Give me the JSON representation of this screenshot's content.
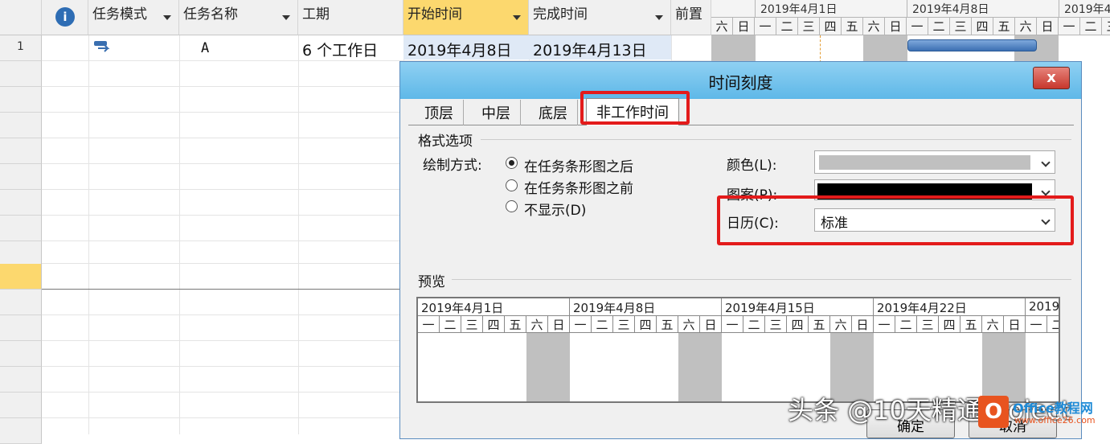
{
  "table": {
    "columns": [
      {
        "label": ""
      },
      {
        "label": "任务模式"
      },
      {
        "label": "任务名称"
      },
      {
        "label": "工期"
      },
      {
        "label": "开始时间"
      },
      {
        "label": "完成时间"
      },
      {
        "label": "前置"
      }
    ],
    "rows": [
      {
        "num": "1",
        "name": "A",
        "duration": "6 个工作日",
        "start": "2019年4月8日",
        "finish": "2019年4月13日"
      }
    ]
  },
  "gantt": {
    "weeks": [
      "2019年4月1日",
      "2019年4月8日",
      "2019年4"
    ],
    "days": [
      "六",
      "日",
      "一",
      "二",
      "三",
      "四",
      "五",
      "六",
      "日",
      "一",
      "二",
      "三",
      "四",
      "五",
      "六",
      "日",
      "一",
      "二",
      "三"
    ]
  },
  "dialog": {
    "title": "时间刻度",
    "close": "x",
    "tabs": [
      "顶层",
      "中层",
      "底层",
      "非工作时间"
    ],
    "section_format": "格式选项",
    "draw_label": "绘制方式:",
    "radio_options": [
      "在任务条形图之后",
      "在任务条形图之前",
      "不显示(D)"
    ],
    "color_label": "颜色(L):",
    "pattern_label": "图案(P):",
    "calendar_label": "日历(C):",
    "calendar_value": "标准",
    "preview_label": "预览",
    "preview_weeks": [
      "2019年4月1日",
      "2019年4月8日",
      "2019年4月15日",
      "2019年4月22日",
      "2019"
    ],
    "preview_days": [
      "一",
      "二",
      "三",
      "四",
      "五",
      "六",
      "日",
      "一",
      "二",
      "三",
      "四",
      "五",
      "六",
      "日",
      "一",
      "二",
      "三",
      "四",
      "五",
      "六",
      "日",
      "一",
      "二",
      "三",
      "四",
      "五",
      "六",
      "日",
      "一",
      "二"
    ],
    "ok_button": "确定",
    "cancel_button": "取消"
  },
  "watermark": {
    "text": "头条 @10天精通Project",
    "logo_text": "Office教程网",
    "logo_url": "www.office26.com"
  },
  "colors": {
    "highlight": "#fcd86e",
    "accent_red": "#e31b1b",
    "gantt_bar": "#4a7ebb"
  }
}
